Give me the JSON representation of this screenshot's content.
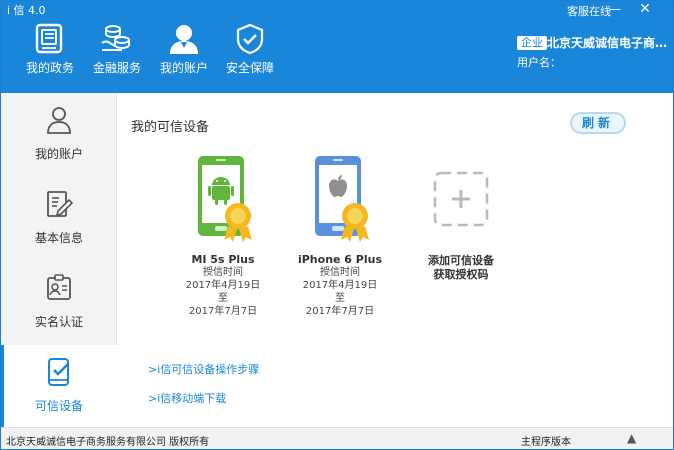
{
  "window": {
    "title": "i 信 4.0"
  },
  "header": {
    "online_status": "客服在线",
    "min_icon": "—",
    "close_icon": "✕",
    "nav": [
      {
        "label": "我的政务",
        "icon": "document-icon"
      },
      {
        "label": "金融服务",
        "icon": "coins-icon"
      },
      {
        "label": "我的账户",
        "icon": "user-icon"
      },
      {
        "label": "安全保障",
        "icon": "shield-icon"
      }
    ],
    "company_badge": "企业",
    "company_name": "北京天威诚信电子商务...",
    "username_label": "用户名："
  },
  "sidebar": {
    "items": [
      {
        "label": "我的账户",
        "icon": "person-icon"
      },
      {
        "label": "基本信息",
        "icon": "edit-document-icon"
      },
      {
        "label": "实名认证",
        "icon": "id-card-icon"
      },
      {
        "label": "可信设备",
        "icon": "trusted-device-icon",
        "active": true
      }
    ]
  },
  "main": {
    "title": "我的可信设备",
    "refresh_label": "刷新",
    "devices": [
      {
        "name": "MI 5s Plus",
        "auth_label": "授信时间",
        "start": "2017年4月19日",
        "sep": "至",
        "end": "2017年7月7日",
        "os": "android"
      },
      {
        "name": "iPhone 6 Plus",
        "auth_label": "授信时间",
        "start": "2017年4月19日",
        "sep": "至",
        "end": "2017年7月7日",
        "os": "apple"
      }
    ],
    "add_device": {
      "line1": "添加可信设备",
      "line2": "获取授权码"
    },
    "links": [
      ">i信可信设备操作步骤",
      ">i信移动端下载"
    ]
  },
  "statusbar": {
    "copyright": "北京天威诚信电子商务服务有限公司 版权所有",
    "version_label": "主程序版本",
    "up_icon": "▲"
  },
  "colors": {
    "primary": "#1a86da",
    "android_green": "#5fb63a",
    "apple_blue": "#5a8fe0",
    "medal_gold": "#f3b81f"
  }
}
